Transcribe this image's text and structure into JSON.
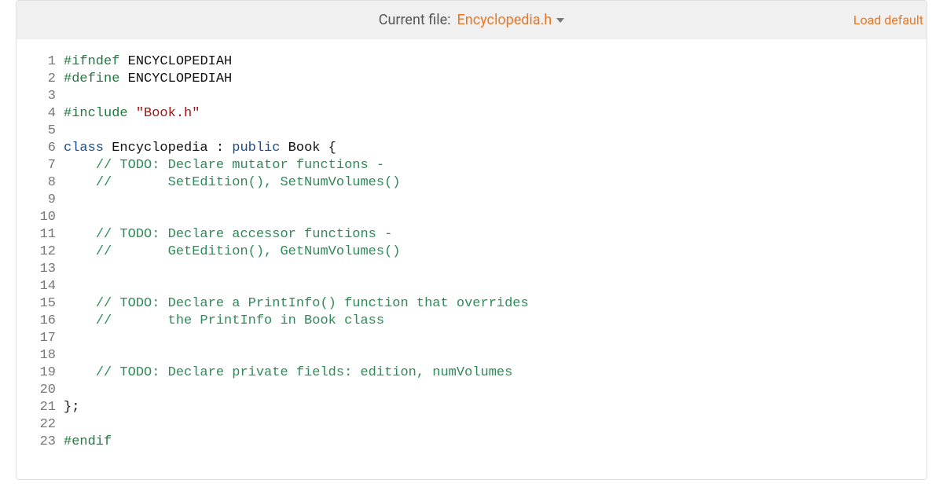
{
  "header": {
    "current_file_label": "Current file:",
    "file_name": "Encyclopedia.h",
    "load_default": "Load default"
  },
  "code": {
    "lines": [
      {
        "n": 1,
        "tokens": [
          {
            "c": "kw-pp",
            "t": "#ifndef"
          },
          {
            "c": "",
            "t": " "
          },
          {
            "c": "id",
            "t": "ENCYCLOPEDIAH"
          }
        ]
      },
      {
        "n": 2,
        "tokens": [
          {
            "c": "kw-pp",
            "t": "#define"
          },
          {
            "c": "",
            "t": " "
          },
          {
            "c": "id",
            "t": "ENCYCLOPEDIAH"
          }
        ]
      },
      {
        "n": 3,
        "tokens": []
      },
      {
        "n": 4,
        "tokens": [
          {
            "c": "kw-pp",
            "t": "#include"
          },
          {
            "c": "",
            "t": " "
          },
          {
            "c": "str",
            "t": "\"Book.h\""
          }
        ]
      },
      {
        "n": 5,
        "tokens": []
      },
      {
        "n": 6,
        "tokens": [
          {
            "c": "kw",
            "t": "class"
          },
          {
            "c": "",
            "t": " "
          },
          {
            "c": "id",
            "t": "Encyclopedia"
          },
          {
            "c": "",
            "t": " : "
          },
          {
            "c": "kw",
            "t": "public"
          },
          {
            "c": "",
            "t": " "
          },
          {
            "c": "id",
            "t": "Book"
          },
          {
            "c": "",
            "t": " {"
          }
        ]
      },
      {
        "n": 7,
        "tokens": [
          {
            "c": "",
            "t": "    "
          },
          {
            "c": "comment",
            "t": "// TODO: Declare mutator functions -"
          }
        ]
      },
      {
        "n": 8,
        "tokens": [
          {
            "c": "",
            "t": "    "
          },
          {
            "c": "comment",
            "t": "//       SetEdition(), SetNumVolumes()"
          }
        ]
      },
      {
        "n": 9,
        "tokens": []
      },
      {
        "n": 10,
        "tokens": []
      },
      {
        "n": 11,
        "tokens": [
          {
            "c": "",
            "t": "    "
          },
          {
            "c": "comment",
            "t": "// TODO: Declare accessor functions -"
          }
        ]
      },
      {
        "n": 12,
        "tokens": [
          {
            "c": "",
            "t": "    "
          },
          {
            "c": "comment",
            "t": "//       GetEdition(), GetNumVolumes()"
          }
        ]
      },
      {
        "n": 13,
        "tokens": []
      },
      {
        "n": 14,
        "tokens": []
      },
      {
        "n": 15,
        "tokens": [
          {
            "c": "",
            "t": "    "
          },
          {
            "c": "comment",
            "t": "// TODO: Declare a PrintInfo() function that overrides"
          }
        ]
      },
      {
        "n": 16,
        "tokens": [
          {
            "c": "",
            "t": "    "
          },
          {
            "c": "comment",
            "t": "//       the PrintInfo in Book class"
          }
        ]
      },
      {
        "n": 17,
        "tokens": []
      },
      {
        "n": 18,
        "tokens": []
      },
      {
        "n": 19,
        "tokens": [
          {
            "c": "",
            "t": "    "
          },
          {
            "c": "comment",
            "t": "// TODO: Declare private fields: edition, numVolumes"
          }
        ]
      },
      {
        "n": 20,
        "tokens": []
      },
      {
        "n": 21,
        "tokens": [
          {
            "c": "id",
            "t": "};"
          }
        ]
      },
      {
        "n": 22,
        "tokens": []
      },
      {
        "n": 23,
        "tokens": [
          {
            "c": "kw-pp",
            "t": "#endif"
          }
        ]
      }
    ]
  }
}
